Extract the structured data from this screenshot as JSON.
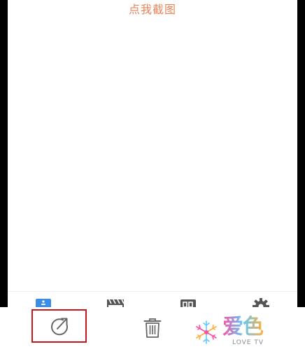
{
  "main": {
    "screenshot_link": "点我截图",
    "link_color": "#e8845a"
  },
  "tabbar": {
    "tabs": [
      {
        "icon": "photo-icon",
        "color": "#3a8ee6",
        "active": true
      },
      {
        "icon": "clapperboard-icon",
        "color": "#555555",
        "active": false
      },
      {
        "icon": "calendar-icon",
        "color": "#555555",
        "active": false
      },
      {
        "icon": "gear-icon",
        "color": "#555555",
        "active": false
      }
    ]
  },
  "toolbar": {
    "share_icon": "share-icon",
    "delete_icon": "trash-icon",
    "highlight_color": "#c8161d",
    "icon_color": "#666666"
  },
  "watermark": {
    "text": "爱色",
    "subtext": "LOVE TV",
    "colors": [
      "#ff4fa3",
      "#5ec8ff",
      "#ffb13b"
    ]
  }
}
